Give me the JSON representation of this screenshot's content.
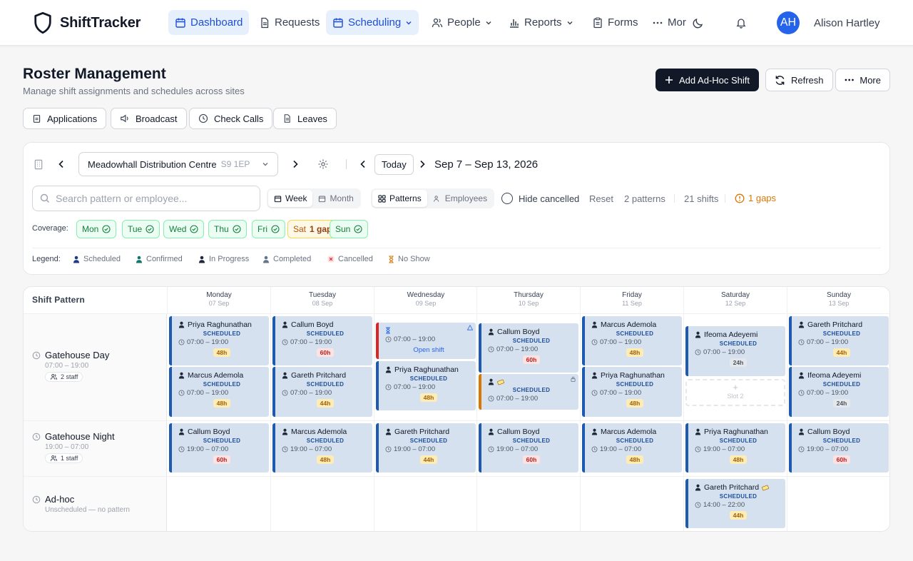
{
  "app": {
    "name": "ShiftTracker",
    "user_name": "Alison Hartley",
    "user_initials": "AH",
    "accent": "#2563eb"
  },
  "nav": {
    "dashboard": "Dashboard",
    "requests": "Requests",
    "scheduling": "Scheduling",
    "people": "People",
    "reports": "Reports",
    "forms": "Forms",
    "more": "Mor"
  },
  "page": {
    "title": "Roster Management",
    "subtitle": "Manage shift assignments and schedules across sites"
  },
  "actions": {
    "add": "Add Ad-Hoc Shift",
    "refresh": "Refresh",
    "more": "More"
  },
  "subtabs": {
    "applications": "Applications",
    "broadcast": "Broadcast",
    "check_calls": "Check Calls",
    "leaves": "Leaves"
  },
  "filters": {
    "site": "Meadowhall Distribution Centre",
    "postcode": "S9 1EP",
    "today": "Today",
    "range": "Sep 7 – Sep 13, 2026",
    "search_placeholder": "Search pattern or employee...",
    "week": "Week",
    "month": "Month",
    "patterns": "Patterns",
    "employees": "Employees",
    "hide_cancelled": "Hide cancelled",
    "reset": "Reset",
    "patterns_count": "2 patterns",
    "shifts_count": "21 shifts",
    "gaps": "1 gaps"
  },
  "coverage": {
    "label": "Coverage:",
    "days": [
      {
        "d": "Mon"
      },
      {
        "d": "Tue"
      },
      {
        "d": "Wed"
      },
      {
        "d": "Thu"
      },
      {
        "d": "Fri"
      },
      {
        "d": "Sat",
        "note": "1 gap"
      },
      {
        "d": "Sun"
      }
    ]
  },
  "legend": {
    "label": "Legend:",
    "items": [
      "Scheduled",
      "Confirmed",
      "In Progress",
      "Completed",
      "Cancelled",
      "No Show"
    ]
  },
  "grid": {
    "pattern_header": "Shift Pattern",
    "days": [
      {
        "name": "Monday",
        "date": "07 Sep"
      },
      {
        "name": "Tuesday",
        "date": "08 Sep"
      },
      {
        "name": "Wednesday",
        "date": "09 Sep"
      },
      {
        "name": "Thursday",
        "date": "10 Sep"
      },
      {
        "name": "Friday",
        "date": "11 Sep"
      },
      {
        "name": "Saturday",
        "date": "12 Sep"
      },
      {
        "name": "Sunday",
        "date": "13 Sep"
      }
    ],
    "patterns": [
      {
        "name": "Gatehouse Day",
        "time": "07:00 – 19:00",
        "staff": "2 staff"
      },
      {
        "name": "Gatehouse Night",
        "time": "19:00 – 07:00",
        "staff": "1 staff"
      },
      {
        "name": "Ad-hoc",
        "time": "Unscheduled — no pattern"
      }
    ],
    "slot_label": "Slot 2",
    "open_shift": "Open shift",
    "status_scheduled": "SCHEDULED",
    "cards": {
      "mon_d1": {
        "emp": "Priya Raghunathan",
        "time": "07:00 – 19:00",
        "hours": "48h"
      },
      "mon_d2": {
        "emp": "Marcus Ademola",
        "time": "07:00 – 19:00",
        "hours": "48h"
      },
      "tue_d1": {
        "emp": "Callum Boyd",
        "time": "07:00 – 19:00",
        "hours": "60h"
      },
      "tue_d2": {
        "emp": "Gareth Pritchard",
        "time": "07:00 – 19:00",
        "hours": "44h"
      },
      "wed_d1": {
        "time": "07:00 – 19:00"
      },
      "wed_d2": {
        "emp": "Priya Raghunathan",
        "time": "07:00 – 19:00",
        "hours": "48h"
      },
      "thu_d1": {
        "emp": "Callum Boyd",
        "time": "07:00 – 19:00",
        "hours": "60h"
      },
      "thu_d2": {
        "time": "07:00 – 19:00"
      },
      "fri_d1": {
        "emp": "Marcus Ademola",
        "time": "07:00 – 19:00",
        "hours": "48h"
      },
      "fri_d2": {
        "emp": "Priya Raghunathan",
        "time": "07:00 – 19:00",
        "hours": "48h"
      },
      "sat_d1": {
        "emp": "Ifeoma Adeyemi",
        "time": "07:00 – 19:00",
        "hours": "24h"
      },
      "sun_d1": {
        "emp": "Gareth Pritchard",
        "time": "07:00 – 19:00",
        "hours": "44h"
      },
      "sun_d2": {
        "emp": "Ifeoma Adeyemi",
        "time": "07:00 – 19:00",
        "hours": "24h"
      },
      "mon_n": {
        "emp": "Callum Boyd",
        "time": "19:00 – 07:00",
        "hours": "60h"
      },
      "tue_n": {
        "emp": "Marcus Ademola",
        "time": "19:00 – 07:00",
        "hours": "48h"
      },
      "wed_n": {
        "emp": "Gareth Pritchard",
        "time": "19:00 – 07:00",
        "hours": "44h"
      },
      "thu_n": {
        "emp": "Callum Boyd",
        "time": "19:00 – 07:00",
        "hours": "60h"
      },
      "fri_n": {
        "emp": "Marcus Ademola",
        "time": "19:00 – 07:00",
        "hours": "48h"
      },
      "sat_n": {
        "emp": "Priya Raghunathan",
        "time": "19:00 – 07:00",
        "hours": "48h"
      },
      "sun_n": {
        "emp": "Callum Boyd",
        "time": "19:00 – 07:00",
        "hours": "60h"
      },
      "sat_a": {
        "emp": "Gareth Pritchard",
        "time": "14:00 – 22:00",
        "hours": "44h"
      }
    }
  }
}
